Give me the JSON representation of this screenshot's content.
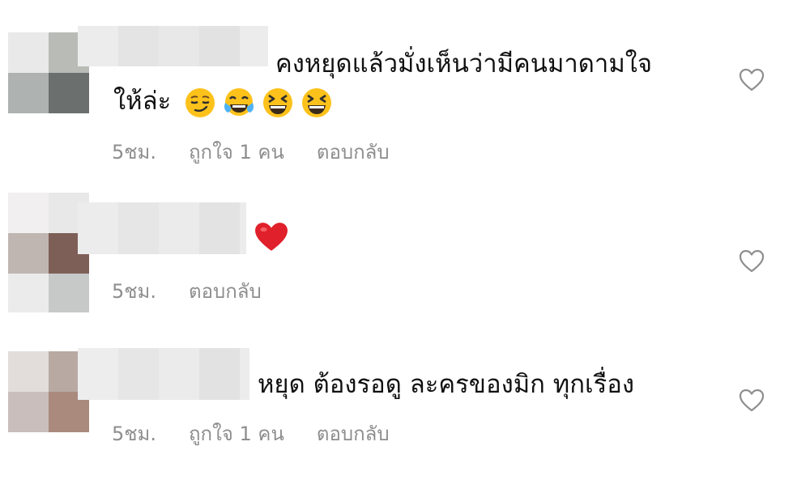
{
  "comments": [
    {
      "text_line1": "คงหยุดแล้วมั่งเห็นว่ามีคนมาดามใจ",
      "text_line2": "ให้ล่ะ",
      "emojis": [
        "smirking-face",
        "face-with-tears-of-joy",
        "grinning-squinting-face",
        "grinning-squinting-face"
      ],
      "time": "5ชม.",
      "likes": "ถูกใจ 1 คน",
      "reply": "ตอบกลับ"
    },
    {
      "emojis": [
        "red-heart"
      ],
      "time": "5ชม.",
      "reply": "ตอบกลับ"
    },
    {
      "text_line1": "หยุด ต้องรอดู ละครของมิก ทุกเรื่อง",
      "time": "5ชม.",
      "likes": "ถูกใจ 1 คน",
      "reply": "ตอบกลับ"
    }
  ],
  "icons": {
    "like": "heart-outline-icon"
  },
  "colors": {
    "text": "#111111",
    "meta": "#8e8e8e",
    "heart_outline": "#8e8e8e",
    "heart_fill": "#e0202a",
    "emoji_yellow": "#fcc21b"
  }
}
